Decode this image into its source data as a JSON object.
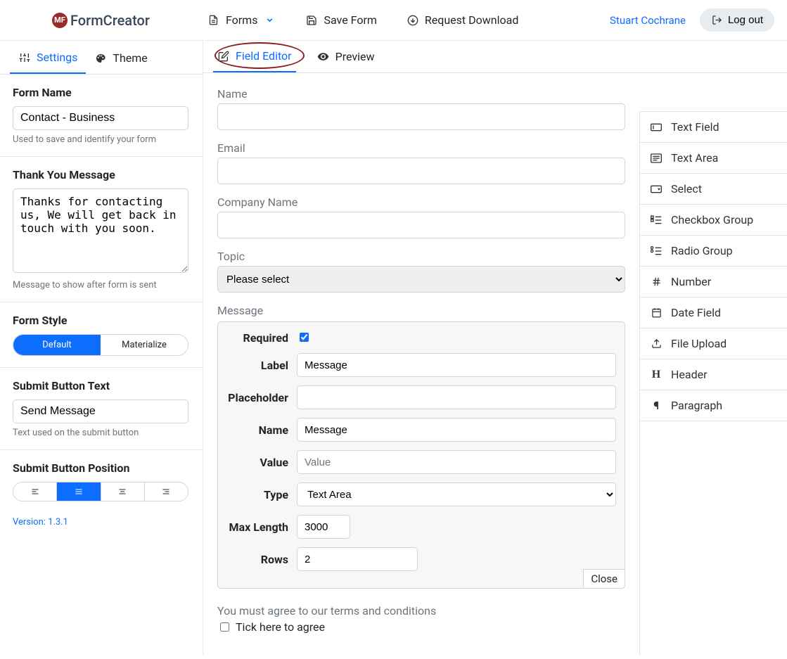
{
  "brand": "FormCreator",
  "brand_badge": "MF",
  "top": {
    "forms": "Forms",
    "save": "Save Form",
    "request": "Request Download",
    "user": "Stuart Cochrane",
    "logout": "Log out"
  },
  "side_tabs": {
    "settings": "Settings",
    "theme": "Theme"
  },
  "sidebar": {
    "form_name_label": "Form Name",
    "form_name_value": "Contact - Business",
    "form_name_help": "Used to save and identify your form",
    "thank_label": "Thank You Message",
    "thank_value": "Thanks for contacting us, We will get back in touch with you soon.",
    "thank_help": "Message to show after form is sent",
    "style_label": "Form Style",
    "style_options": [
      "Default",
      "Materialize"
    ],
    "submit_text_label": "Submit Button Text",
    "submit_text_value": "Send Message",
    "submit_text_help": "Text used on the submit button",
    "submit_pos_label": "Submit Button Position",
    "version": "Version: 1.3.1"
  },
  "center_tabs": {
    "editor": "Field Editor",
    "preview": "Preview"
  },
  "fields": {
    "name": "Name",
    "email": "Email",
    "company": "Company Name",
    "topic": "Topic",
    "topic_option": "Please select",
    "message": "Message",
    "agree_label": "You must agree to our terms and conditions",
    "agree_tick": "Tick here to agree"
  },
  "editor": {
    "required": "Required",
    "label_l": "Label",
    "label_v": "Message",
    "placeholder_l": "Placeholder",
    "placeholder_v": "",
    "name_l": "Name",
    "name_v": "Message",
    "value_l": "Value",
    "value_ph": "Value",
    "type_l": "Type",
    "type_v": "Text Area",
    "maxlen_l": "Max Length",
    "maxlen_v": "3000",
    "rows_l": "Rows",
    "rows_v": "2",
    "close": "Close"
  },
  "palette": [
    "Text Field",
    "Text Area",
    "Select",
    "Checkbox Group",
    "Radio Group",
    "Number",
    "Date Field",
    "File Upload",
    "Header",
    "Paragraph"
  ]
}
